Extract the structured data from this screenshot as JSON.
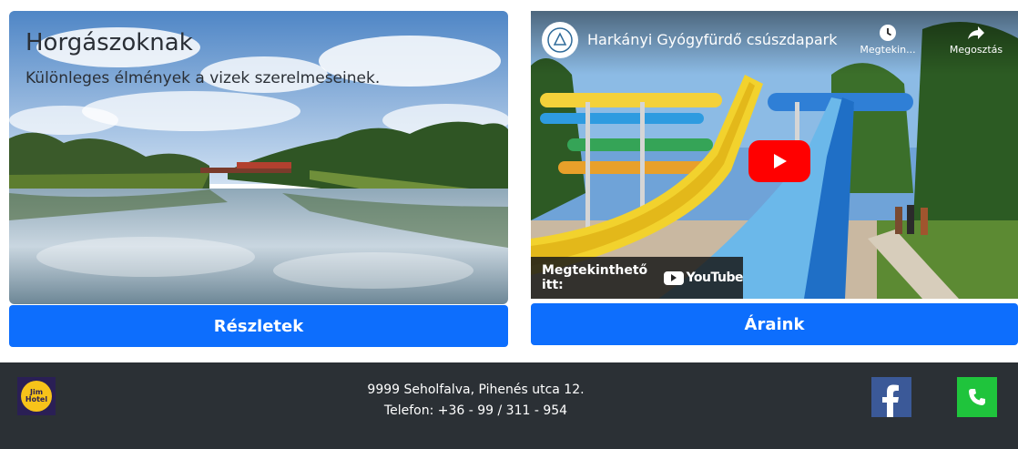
{
  "left_card": {
    "title": "Horgászoknak",
    "subtitle": "Különleges élmények a vizek szerelmeseinek.",
    "button_label": "Részletek"
  },
  "video": {
    "title": "Harkányi Gyógyfürdő csúszdapark",
    "watch_later_label": "Megtekin...",
    "share_label": "Megosztás",
    "watch_on_label": "Megtekinthető itt:",
    "youtube_label": "YouTube",
    "play_icon": "play-icon"
  },
  "right_button": {
    "label": "Áraink"
  },
  "footer": {
    "address": "9999 Seholfalva, Pihenés utca 12.",
    "phone": "Telefon: +36 - 99 / 311 - 954",
    "logo_text_top": "Jim",
    "logo_text_bottom": "Hotel"
  },
  "colors": {
    "primary_button": "#0d6efd",
    "footer_bg": "#2b3035",
    "facebook": "#3b5998",
    "phone": "#1fc43c",
    "youtube_red": "#ff0000"
  }
}
